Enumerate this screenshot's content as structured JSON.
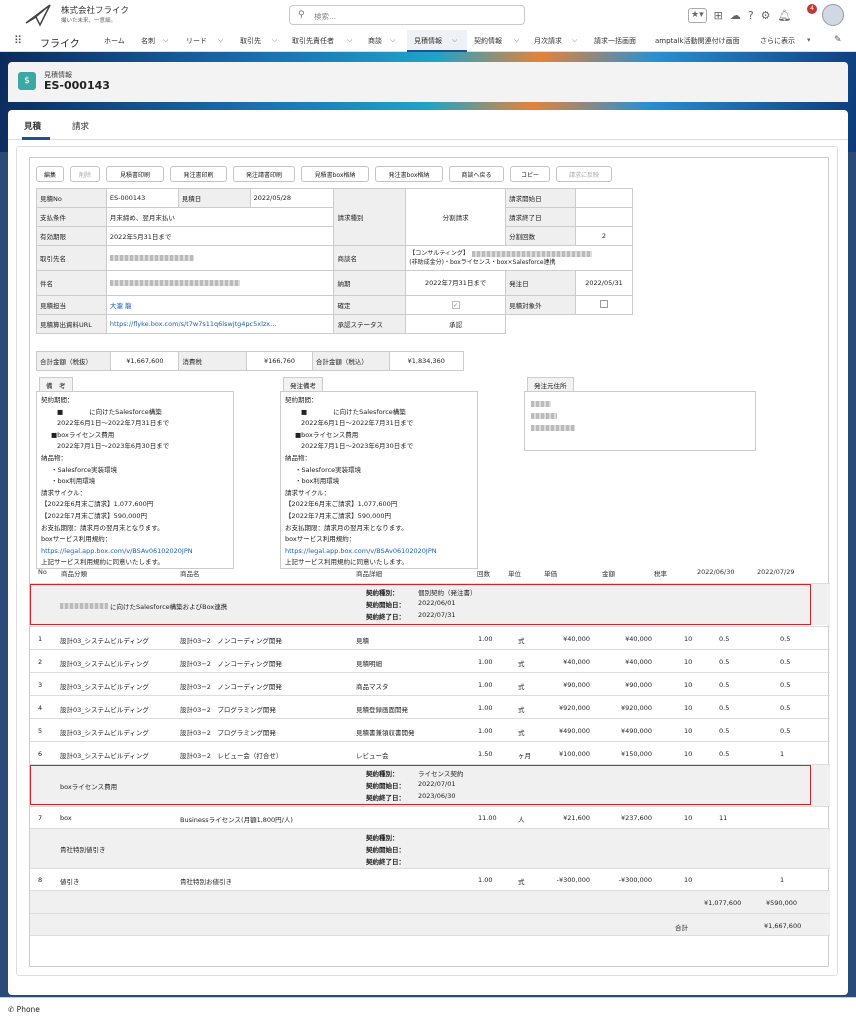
{
  "company": {
    "name": "株式会社フライク",
    "tagline": "撮いた未来、一意細。"
  },
  "search": {
    "placeholder": "検索..."
  },
  "header_icons": {
    "notification_count": "4"
  },
  "nav": {
    "app_name": "フライク",
    "items": [
      "ホーム",
      "名刺",
      "リード",
      "取引先",
      "取引先責任者",
      "商談",
      "見積情報",
      "契約情報",
      "月次請求",
      "請求一括画面",
      "amptalk活動関連付け画面",
      "さらに表示"
    ],
    "active": "見積情報"
  },
  "record": {
    "object_label": "見積情報",
    "name": "ES-000143"
  },
  "tabs": [
    "見積",
    "請求"
  ],
  "buttons": [
    "編集",
    "削除",
    "見積書印刷",
    "発注書印刷",
    "発注請書印刷",
    "見積書box格納",
    "発注書box格納",
    "商談へ戻る",
    "コピー",
    "請求に反映"
  ],
  "fields": {
    "quote_no_label": "見積No",
    "quote_no": "ES-000143",
    "quote_date_label": "見積日",
    "quote_date": "2022/05/28",
    "payment_terms_label": "支払条件",
    "payment_terms": "月末締め、翌月末払い",
    "valid_until_label": "有効期限",
    "valid_until": "2022年5月31日まで",
    "billing_type_label": "請求種別",
    "billing_type": "分割請求",
    "billing_start_label": "請求開始日",
    "billing_start": "",
    "billing_end_label": "請求終了日",
    "billing_end": "",
    "split_count_label": "分割回数",
    "split_count": "2",
    "customer_label": "取引先名",
    "deal_name_label": "商談名",
    "deal_name_line1": "【コンサルティング】",
    "deal_name_line2": "(非助成金分)・boxライセンス・box×Salesforce連携",
    "subject_label": "件名",
    "delivery_label": "納期",
    "delivery_date": "2022年7月31日まで",
    "order_date_label": "発注日",
    "order_date": "2022/05/31",
    "owner_label": "見積担当",
    "owner": "大瀧 龍",
    "confirmed_label": "確定",
    "excluded_label": "見積対象外",
    "material_url_label": "見積算出資料URL",
    "material_url": "https://flyke.box.com/s/t7w7s11q6lswjtg4pc5xlzx...",
    "approval_label": "承認ステータス",
    "approval_status": "承認"
  },
  "totals": {
    "subtotal_label": "合計金額（税抜）",
    "subtotal": "¥1,667,600",
    "tax_label": "消費税",
    "tax": "¥166,760",
    "total_label": "合計金額（税込）",
    "total": "¥1,834,360"
  },
  "remarks": {
    "label": "備　考",
    "lines": [
      "契約期間：",
      "■　　　　に向けたSalesforce構築",
      "2022年6月1日〜2022年7月31日まで",
      "■boxライセンス費用",
      "2022年7月1日〜2023年6月30日まで",
      "納品物：",
      "・Salesforce実装環境",
      "・box利用環境",
      "請求サイクル：",
      "【2022年6月末ご請求】1,077,600円",
      "【2022年7月末ご請求】590,000円",
      "お支払期限：請求月の翌月末となります。",
      "boxサービス利用規約：",
      "https://legal.app.box.com/v/BSAv06102020JPN",
      "上記サービス利用規約に同意いたします。"
    ]
  },
  "order_remarks": {
    "label": "発注備考",
    "lines": [
      "契約期間：",
      "■　　　　に向けたSalesforce構築",
      "2022年6月1日〜2022年7月31日まで",
      "■boxライセンス費用",
      "2022年7月1日〜2023年6月30日まで",
      "納品物：",
      "・Salesforce実装環境",
      "・box利用環境",
      "請求サイクル：",
      "【2022年6月末ご請求】1,077,600円",
      "【2022年7月末ご請求】590,000円",
      "お支払期限：請求月の翌月末となります。",
      "boxサービス利用規約：",
      "https://legal.app.box.com/v/BSAv06102020JPN",
      "上記サービス利用規約に同意いたします。"
    ]
  },
  "order_address": {
    "label": "発注元住所"
  },
  "item_columns": [
    "No",
    "商品分類",
    "商品名",
    "商品詳細",
    "回数",
    "単位",
    "単価",
    "金額",
    "税率",
    "2022/06/30",
    "2022/07/29"
  ],
  "contract_label_type": "契約種別：",
  "contract_label_start": "契約開始日：",
  "contract_label_end": "契約終了日：",
  "section1": {
    "title": "に向けたSalesforce構築およびBox連携",
    "type": "個別契約（発注書）",
    "start": "2022/06/01",
    "end": "2022/07/31"
  },
  "section2": {
    "title": "boxライセンス費用",
    "type": "ライセンス契約",
    "start": "2022/07/01",
    "end": "2023/06/30"
  },
  "section3": {
    "title": "貴社特別値引き",
    "type": "",
    "start": "",
    "end": ""
  },
  "rows": [
    {
      "no": "1",
      "cat": "設計03_システムビルディング",
      "name": "設計03−2　ノンコーディング開発",
      "detail": "見積",
      "qty": "1.00",
      "unit": "式",
      "price": "¥40,000",
      "amount": "¥40,000",
      "tax": "10",
      "m1": "0.5",
      "m2": "0.5"
    },
    {
      "no": "2",
      "cat": "設計03_システムビルディング",
      "name": "設計03−2　ノンコーディング開発",
      "detail": "見積明細",
      "qty": "1.00",
      "unit": "式",
      "price": "¥40,000",
      "amount": "¥40,000",
      "tax": "10",
      "m1": "0.5",
      "m2": "0.5"
    },
    {
      "no": "3",
      "cat": "設計03_システムビルディング",
      "name": "設計03−2　ノンコーディング開発",
      "detail": "商品マスタ",
      "qty": "1.00",
      "unit": "式",
      "price": "¥90,000",
      "amount": "¥90,000",
      "tax": "10",
      "m1": "0.5",
      "m2": "0.5"
    },
    {
      "no": "4",
      "cat": "設計03_システムビルディング",
      "name": "設計03−2　プログラミング開発",
      "detail": "見積登録画面開発",
      "qty": "1.00",
      "unit": "式",
      "price": "¥920,000",
      "amount": "¥920,000",
      "tax": "10",
      "m1": "0.5",
      "m2": "0.5"
    },
    {
      "no": "5",
      "cat": "設計03_システムビルディング",
      "name": "設計03−2　プログラミング開発",
      "detail": "見積書兼領収書開発",
      "qty": "1.00",
      "unit": "式",
      "price": "¥490,000",
      "amount": "¥490,000",
      "tax": "10",
      "m1": "0.5",
      "m2": "0.5"
    },
    {
      "no": "6",
      "cat": "設計03_システムビルディング",
      "name": "設計03−2　レビュー会（打合せ）",
      "detail": "レビュー会",
      "qty": "1.50",
      "unit": "ヶ月",
      "price": "¥100,000",
      "amount": "¥150,000",
      "tax": "10",
      "m1": "0.5",
      "m2": "1"
    },
    {
      "no": "7",
      "cat": "box",
      "name": "Businessライセンス(月額1,800円/人)",
      "detail": "",
      "qty": "11.00",
      "unit": "人",
      "price": "¥21,600",
      "amount": "¥237,600",
      "tax": "10",
      "m1": "11",
      "m2": ""
    },
    {
      "no": "8",
      "cat": "値引き",
      "name": "貴社特別お値引き",
      "detail": "",
      "qty": "1.00",
      "unit": "式",
      "price": "-¥300,000",
      "amount": "-¥300,000",
      "tax": "10",
      "m1": "",
      "m2": "1"
    }
  ],
  "month_totals": {
    "m1": "¥1,077,600",
    "m2": "¥590,000"
  },
  "grand_total": {
    "label": "合計",
    "value": "¥1,667,600"
  },
  "utility_bar": {
    "phone": "Phone"
  }
}
